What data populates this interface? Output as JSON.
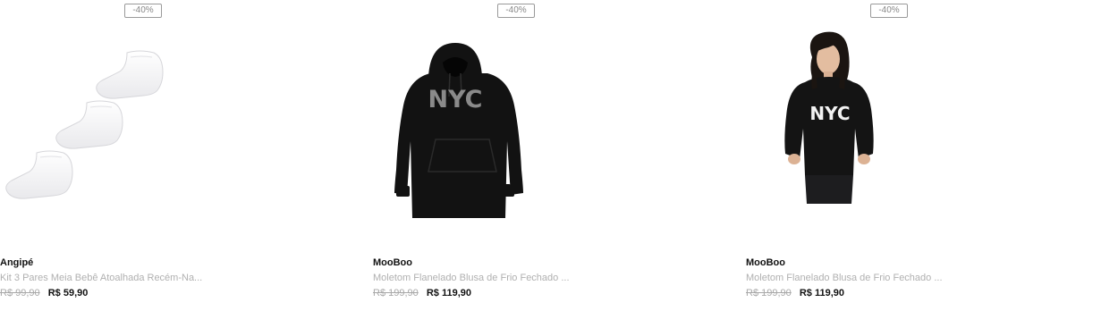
{
  "products": [
    {
      "badge": "-40%",
      "image_icon": "socks-image",
      "brand": "Angipé",
      "name": "Kit 3 Pares Meia Bebê Atoalhada Recém-Na...",
      "old_price": "R$ 99,90",
      "price": "R$ 59,90"
    },
    {
      "badge": "-40%",
      "image_icon": "hoodie-image",
      "brand": "MooBoo",
      "name": "Moletom Flanelado Blusa de Frio Fechado ...",
      "old_price": "R$ 199,90",
      "price": "R$ 119,90",
      "print_text": "NYC"
    },
    {
      "badge": "-40%",
      "image_icon": "model-hoodie-image",
      "brand": "MooBoo",
      "name": "Moletom Flanelado Blusa de Frio Fechado ...",
      "old_price": "R$ 199,90",
      "price": "R$ 119,90",
      "print_text": "NYC"
    }
  ],
  "colors": {
    "badge_border": "#9a9a9a",
    "old_price": "#a8a8a8",
    "description": "#b0b0b0",
    "price": "#111111"
  }
}
